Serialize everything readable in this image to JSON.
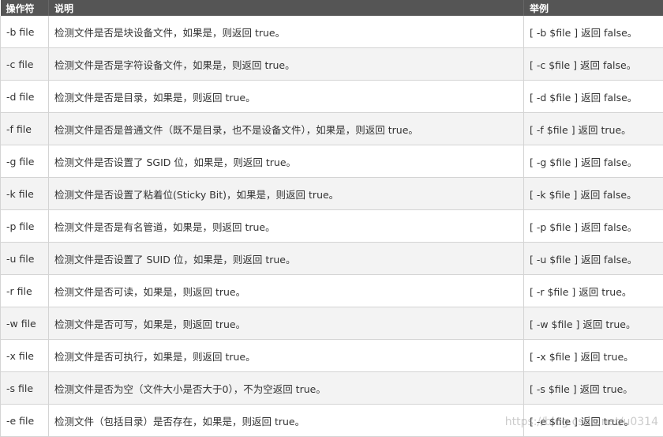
{
  "headers": [
    "操作符",
    "说明",
    "举例"
  ],
  "rows": [
    {
      "op": "-b file",
      "desc": "检测文件是否是块设备文件，如果是，则返回 true。",
      "example": "[ -b $file ] 返回 false。"
    },
    {
      "op": "-c file",
      "desc": "检测文件是否是字符设备文件，如果是，则返回 true。",
      "example": "[ -c $file ] 返回 false。"
    },
    {
      "op": "-d file",
      "desc": "检测文件是否是目录，如果是，则返回 true。",
      "example": "[ -d $file ] 返回 false。"
    },
    {
      "op": "-f file",
      "desc": "检测文件是否是普通文件（既不是目录，也不是设备文件），如果是，则返回 true。",
      "example": "[ -f $file ] 返回 true。"
    },
    {
      "op": "-g file",
      "desc": "检测文件是否设置了 SGID 位，如果是，则返回 true。",
      "example": "[ -g $file ] 返回 false。"
    },
    {
      "op": "-k file",
      "desc": "检测文件是否设置了粘着位(Sticky Bit)，如果是，则返回 true。",
      "example": "[ -k $file ] 返回 false。"
    },
    {
      "op": "-p file",
      "desc": "检测文件是否是有名管道，如果是，则返回 true。",
      "example": "[ -p $file ] 返回 false。"
    },
    {
      "op": "-u file",
      "desc": "检测文件是否设置了 SUID 位，如果是，则返回 true。",
      "example": "[ -u $file ] 返回 false。"
    },
    {
      "op": "-r file",
      "desc": "检测文件是否可读，如果是，则返回 true。",
      "example": "[ -r $file ] 返回 true。"
    },
    {
      "op": "-w file",
      "desc": "检测文件是否可写，如果是，则返回 true。",
      "example": "[ -w $file ] 返回 true。"
    },
    {
      "op": "-x file",
      "desc": "检测文件是否可执行，如果是，则返回 true。",
      "example": "[ -x $file ] 返回 true。"
    },
    {
      "op": "-s file",
      "desc": "检测文件是否为空（文件大小是否大于0），不为空返回 true。",
      "example": "[ -s $file ] 返回 true。"
    },
    {
      "op": "-e file",
      "desc": "检测文件（包括目录）是否存在，如果是，则返回 true。",
      "example": "[ -e $file ] 返回 true。"
    }
  ],
  "watermark": "https://blog.csdn.net/u0314"
}
